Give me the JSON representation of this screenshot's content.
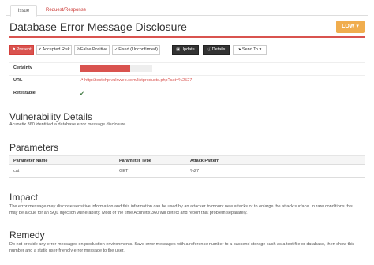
{
  "tabs": [
    {
      "label": "Issue",
      "active": true
    },
    {
      "label": "Request/Response",
      "active": false
    }
  ],
  "issue": {
    "title": "Database Error Message Disclosure",
    "severity": "LOW",
    "severity_color": "#f0ad4e"
  },
  "toolbar": {
    "present": "Present",
    "accepted_risk": "Accepted Risk",
    "false_positive": "False Positive",
    "fixed_unconfirmed": "Fixed (Unconfirmed)",
    "update": "Update",
    "details": "Details",
    "send_to": "Send To"
  },
  "properties": {
    "certainty_label": "Certainty",
    "certainty_value": 0.7,
    "url_label": "URL",
    "url": "http://testphp.vulnweb.com/listproducts.php?cat=%2527",
    "retestable_label": "Retestable"
  },
  "vulnerability_details": {
    "heading": "Vulnerability Details",
    "text": "Acunetix 360 identified a database error message disclosure."
  },
  "parameters": {
    "heading": "Parameters",
    "columns": [
      "Parameter Name",
      "Parameter Type",
      "Attack Pattern"
    ],
    "rows": [
      [
        "cat",
        "GET",
        "%27"
      ]
    ]
  },
  "impact": {
    "heading": "Impact",
    "line1": "The error message may disclose sensitive information and this information can be used by an attacker to mount new attacks or to enlarge the attack surface. In rare conditions this",
    "line2": "may be a clue for an SQL injection vulnerability. Most of the time Acunetix 360 will detect and report that problem separately."
  },
  "remedy": {
    "heading": "Remedy",
    "line1": "Do not provide any error messages on production environments. Save error messages with a reference number to a backend storage such as a text file or database, then show this",
    "line2": "number and a static user-friendly error message to the user."
  },
  "colors": {
    "accent": "#d9534f",
    "dark_button": "#333333",
    "success": "#3c763d"
  }
}
